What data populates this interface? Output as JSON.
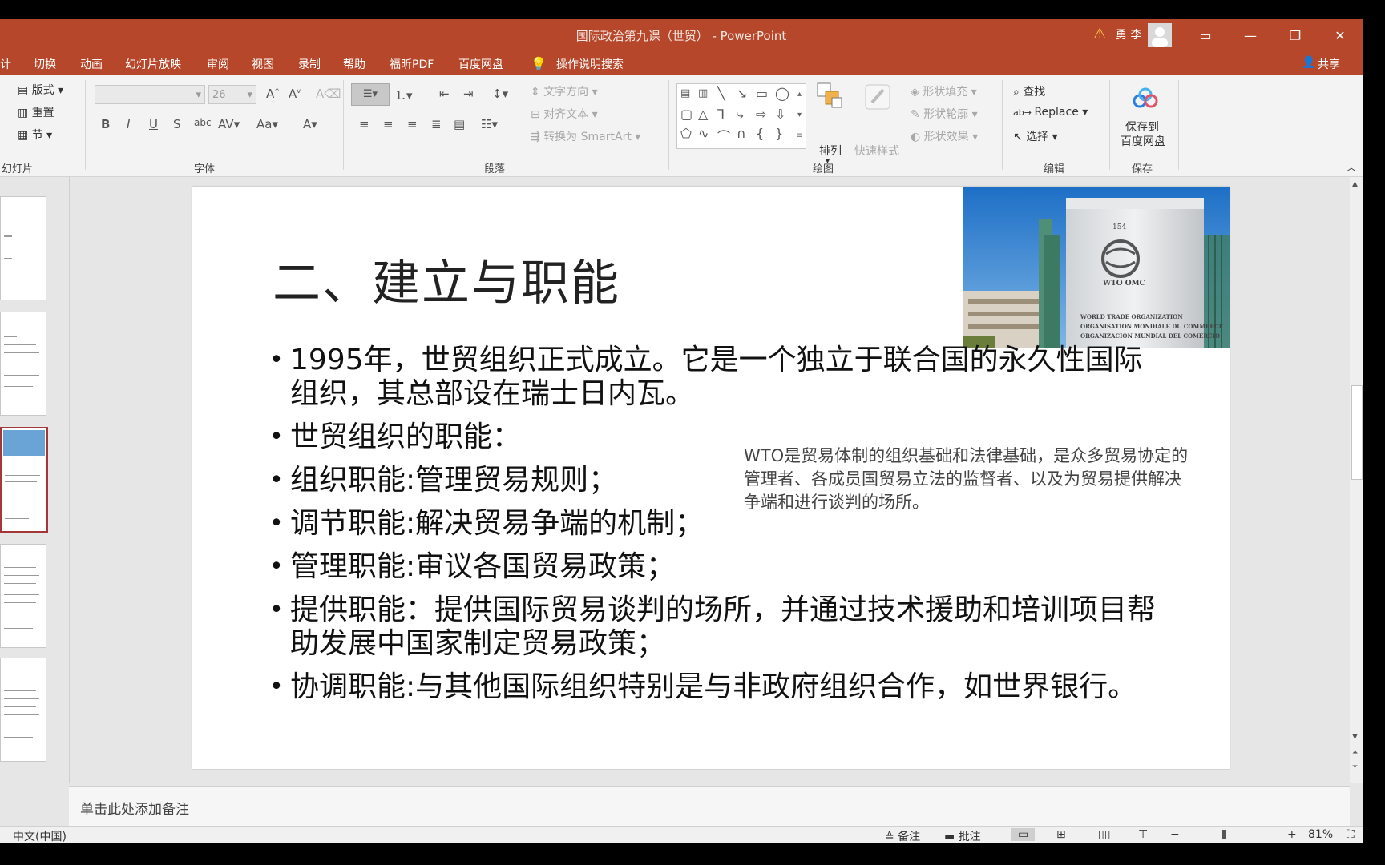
{
  "window": {
    "doc_title": "国际政治第九课（世贸）  -  PowerPoint",
    "user_name": "勇 李",
    "warning_icon": "warning-icon",
    "controls": [
      "ribbon-display-icon",
      "minimize-icon",
      "restore-icon",
      "close-icon"
    ]
  },
  "tabs": [
    "计",
    "切换",
    "动画",
    "幻灯片放映",
    "审阅",
    "视图",
    "录制",
    "帮助",
    "福昕PDF",
    "百度网盘"
  ],
  "tell_me": "操作说明搜索",
  "share": "共享",
  "ribbon": {
    "slides_group": {
      "layout": "版式",
      "reset": "重置",
      "section": "节",
      "label": "幻灯片"
    },
    "font_group": {
      "font_name": "",
      "font_size": "26",
      "label": "字体"
    },
    "paragraph_group": {
      "text_direction": "文字方向",
      "align_text": "对齐文本",
      "convert_smartart": "转换为 SmartArt",
      "label": "段落"
    },
    "drawing_group": {
      "arrange": "排列",
      "quick_styles": "快速样式",
      "shape_fill": "形状填充",
      "shape_outline": "形状轮廓",
      "shape_effects": "形状效果",
      "label": "绘图"
    },
    "editing_group": {
      "find": "查找",
      "replace": "Replace",
      "select": "选择",
      "label": "编辑"
    },
    "save_group": {
      "save_to_baidu_line1": "保存到",
      "save_to_baidu_line2": "百度网盘",
      "label": "保存"
    }
  },
  "slide": {
    "title": "二、建立与职能",
    "photo": {
      "sign_number": "154",
      "sign_title": "WTO OMC",
      "sign_line1": "WORLD TRADE ORGANIZATION",
      "sign_line2": "ORGANISATION MONDIALE DU COMMERCE",
      "sign_line3": "ORGANIZACION MUNDIAL DEL COMERCIO"
    },
    "bullets": [
      "1995年，世贸组织正式成立。它是一个独立于联合国的永久性国际组织，其总部设在瑞士日内瓦。",
      "世贸组织的职能：",
      "组织职能:管理贸易规则；",
      "调节职能:解决贸易争端的机制；",
      "管理职能:审议各国贸易政策；",
      "提供职能：提供国际贸易谈判的场所，并通过技术援助和培训项目帮助发展中国家制定贸易政策；",
      "协调职能:与其他国际组织特别是与非政府组织合作，如世界银行。"
    ],
    "side_note": "WTO是贸易体制的组织基础和法律基础，是众多贸易协定的管理者、各成员国贸易立法的监督者、以及为贸易提供解决争端和进行谈判的场所。"
  },
  "notes_placeholder": "单击此处添加备注",
  "status": {
    "language": "中文(中国)",
    "notes_btn": "备注",
    "comments_btn": "批注",
    "zoom": "81%",
    "zoom_level": 0.81
  },
  "colors": {
    "accent": "#b7472a",
    "selected_thumb": "#a4373a"
  }
}
